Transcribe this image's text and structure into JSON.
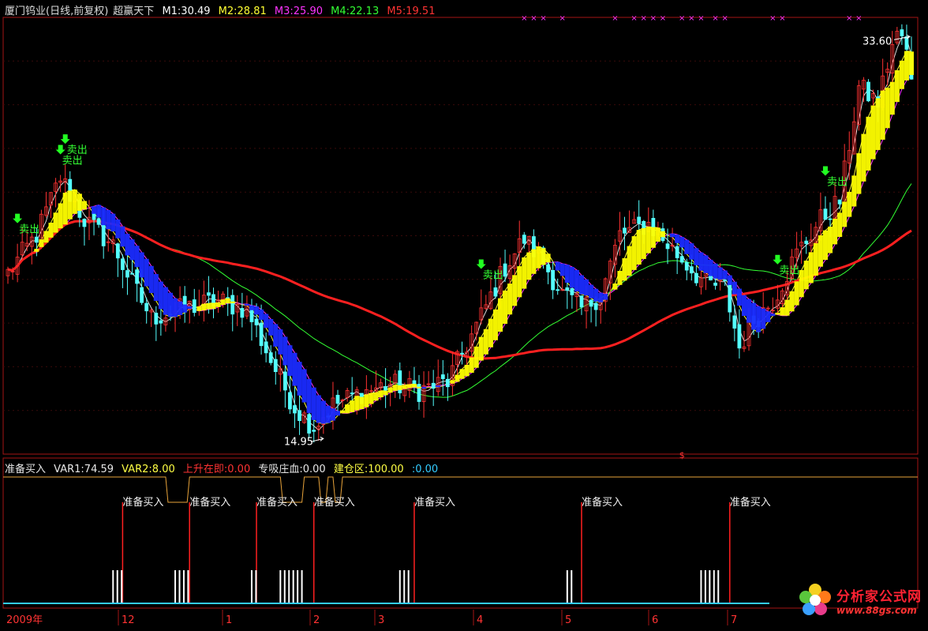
{
  "header": {
    "title": "厦门钨业(日线,前复权)",
    "indicator": "超赢天下",
    "ma": [
      {
        "label": "M1:30.49",
        "color": "#ffffff"
      },
      {
        "label": "M2:28.81",
        "color": "#ffff33"
      },
      {
        "label": "M3:25.90",
        "color": "#ff33ff"
      },
      {
        "label": "M4:22.13",
        "color": "#33ff33"
      },
      {
        "label": "M5:19.51",
        "color": "#ff3333"
      }
    ]
  },
  "sub_header": [
    {
      "label": "准备买入",
      "color": "#e8e8e8"
    },
    {
      "label": "VAR1:74.59",
      "color": "#e8e8e8"
    },
    {
      "label": "VAR2:8.00",
      "color": "#ffff44"
    },
    {
      "label": "上升在即:0.00",
      "color": "#ff3030"
    },
    {
      "label": "专吸庄血:0.00",
      "color": "#e8e8e8"
    },
    {
      "label": "建仓区:100.00",
      "color": "#ffff44"
    },
    {
      "label": ":0.00",
      "color": "#33ccff"
    }
  ],
  "x_axis": {
    "labels": [
      "2009年",
      "12",
      "1",
      "2",
      "3",
      "4",
      "5",
      "6",
      "7"
    ],
    "year_color": "#ff3333",
    "month_color": "#ff3333"
  },
  "logo": {
    "name": "分析家公式网",
    "url_text": "www.88gs.com"
  },
  "chart_data": {
    "type": "candlestick",
    "price_range": [
      14.0,
      34.5
    ],
    "high_label": "33.60",
    "low_label": "14.95",
    "signals": {
      "sell_label": "卖出",
      "sell_bars": [
        2,
        11,
        12,
        99,
        161,
        171
      ],
      "buy_label": "准备买入",
      "buy_bars": [
        24,
        38,
        52,
        64,
        85,
        120,
        151
      ]
    },
    "marker_x_bars": [
      108,
      110,
      112,
      116,
      127,
      131,
      133,
      135,
      137,
      141,
      143,
      145,
      148,
      150,
      160,
      162,
      176,
      178
    ]
  }
}
